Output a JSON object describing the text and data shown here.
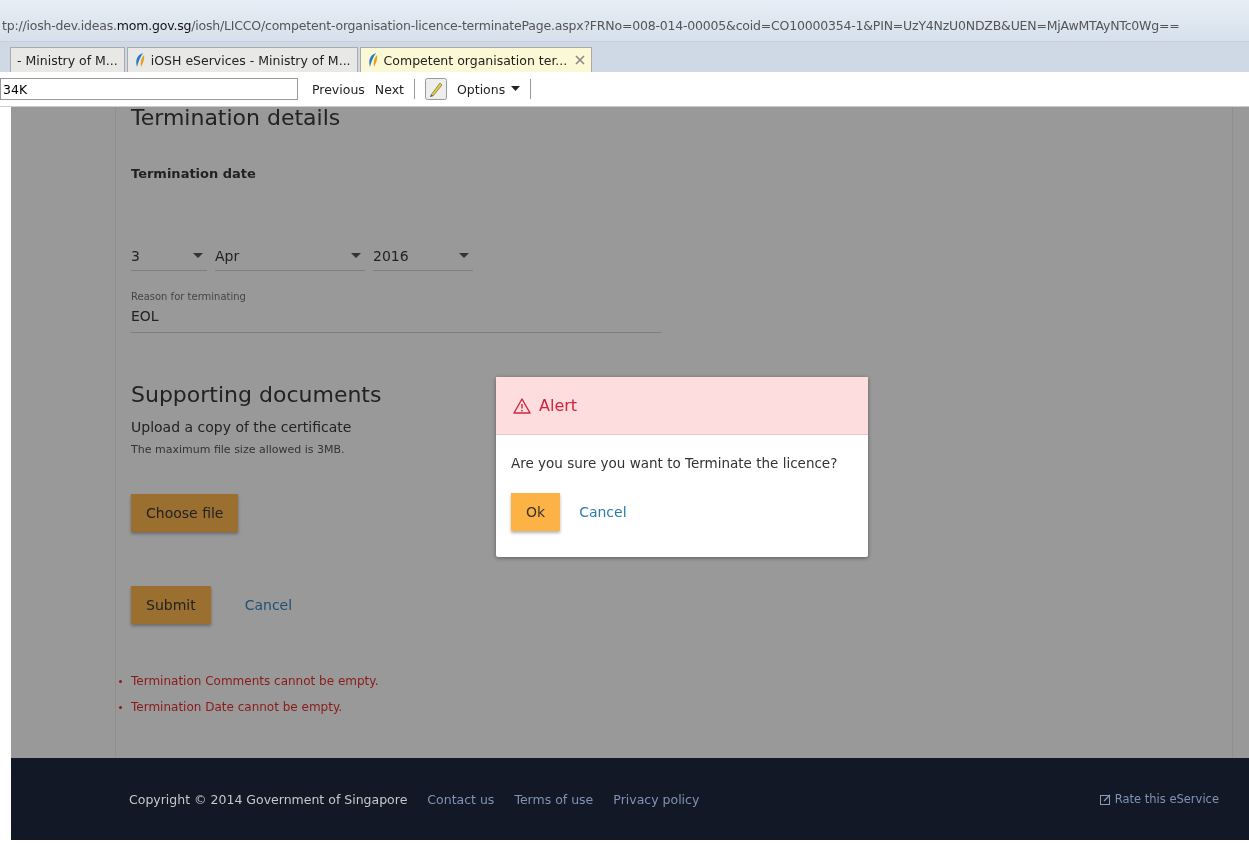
{
  "browser": {
    "address": {
      "prefix": "tp://iosh-dev.ideas.",
      "domain": "mom.gov.sg",
      "path": "/iosh/LICCO/competent-organisation-licence-terminatePage.aspx?FRNo=008-014-00005&coid=CO10000354-1&PIN=UzY4NzU0NDZB&UEN=MjAwMTAyNTc0Wg=="
    },
    "tabs": [
      {
        "label": "- Ministry of M...",
        "selected": false,
        "icon": false
      },
      {
        "label": "iOSH eServices - Ministry of M...",
        "selected": false,
        "icon": true
      },
      {
        "label": "Competent organisation ter...",
        "selected": true,
        "icon": true
      }
    ],
    "find_bar": {
      "value": "34K",
      "buttons": [
        "Previous",
        "Next"
      ],
      "options": "Options"
    }
  },
  "page": {
    "heading": "Termination details",
    "date_label": "Termination date",
    "date_selects": [
      {
        "value": "3"
      },
      {
        "value": "Apr"
      },
      {
        "value": "2016"
      }
    ],
    "reason": {
      "label": "Reason for terminating",
      "value": "EOL"
    },
    "docs_heading": "Supporting documents",
    "upload_label": "Upload a copy of the certificate",
    "size_note": "The maximum file size allowed is 3MB.",
    "choose_button": "Choose file",
    "submit_button": "Submit",
    "cancel_link": "Cancel",
    "errors": [
      "Termination Comments cannot be empty.",
      "Termination Date cannot be empty."
    ]
  },
  "dialog": {
    "title": "Alert",
    "message": "Are you sure you want to Terminate the licence?",
    "ok": "Ok",
    "cancel": "Cancel"
  },
  "footer": {
    "copyright": "Copyright © 2014 Government of Singapore",
    "links": [
      "Contact us",
      "Terms of use",
      "Privacy policy"
    ],
    "rate": "Rate this eService"
  }
}
